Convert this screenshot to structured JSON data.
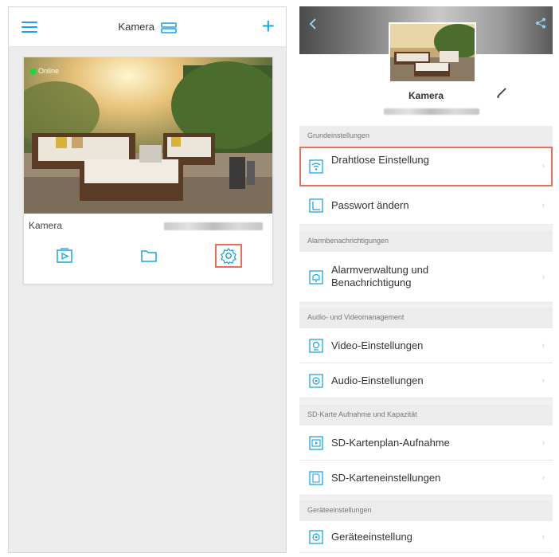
{
  "left_panel": {
    "title": "Kamera",
    "card": {
      "status": "Online",
      "name": "Kamera"
    }
  },
  "right_panel": {
    "camera_name": "Kamera",
    "sections": [
      {
        "header": "Grundeinstellungen",
        "items": [
          {
            "label": "Drahtlose Einstellung",
            "icon": "wifi-icon",
            "highlighted": true
          },
          {
            "label": "Passwort ändern",
            "icon": "password-icon"
          }
        ]
      },
      {
        "header": "Alarmbenachrichtigungen",
        "items": [
          {
            "label": "Alarmverwaltung und Benachrichtigung",
            "icon": "alarm-icon"
          }
        ]
      },
      {
        "header": "Audio- und Videomanagement",
        "items": [
          {
            "label": "Video-Einstellungen",
            "icon": "video-icon"
          },
          {
            "label": "Audio-Einstellungen",
            "icon": "audio-icon"
          }
        ]
      },
      {
        "header": "SD-Karte Aufnahme und Kapazität",
        "items": [
          {
            "label": "SD-Kartenplan-Aufnahme",
            "icon": "sd-schedule-icon"
          },
          {
            "label": "SD-Karteneinstellungen",
            "icon": "sd-settings-icon"
          }
        ]
      },
      {
        "header": "Geräteeinstellungen",
        "items": [
          {
            "label": "Geräteeinstellung",
            "icon": "device-icon"
          }
        ]
      }
    ]
  },
  "colors": {
    "accent": "#1aa3e8",
    "highlight": "#e8705a",
    "online": "#2ecc40"
  }
}
